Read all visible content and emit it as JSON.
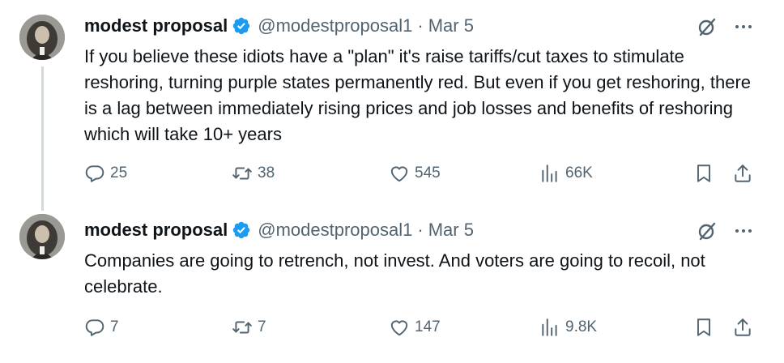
{
  "tweets": [
    {
      "author": {
        "name": "modest proposal",
        "handle": "@modestproposal1",
        "verified": true
      },
      "separator": "·",
      "date": "Mar 5",
      "text": "If you believe these idiots have a \"plan\" it's raise tariffs/cut taxes to stimulate reshoring, turning purple states permanently red. But even if you get reshoring, there is a lag between immediately rising prices and job losses and benefits of reshoring which will take 10+ years",
      "stats": {
        "replies": "25",
        "reposts": "38",
        "likes": "545",
        "views": "66K"
      }
    },
    {
      "author": {
        "name": "modest proposal",
        "handle": "@modestproposal1",
        "verified": true
      },
      "separator": "·",
      "date": "Mar 5",
      "text": "Companies are going to retrench, not invest. And voters are going to recoil, not celebrate.",
      "stats": {
        "replies": "7",
        "reposts": "7",
        "likes": "147",
        "views": "9.8K"
      }
    }
  ],
  "icons": {
    "verified": "verified-badge-icon",
    "grok": "grok-icon",
    "more": "more-icon",
    "reply": "reply-icon",
    "repost": "repost-icon",
    "like": "like-icon",
    "views": "views-icon",
    "bookmark": "bookmark-icon",
    "share": "share-icon"
  },
  "colors": {
    "verified": "#1d9bf0",
    "text": "#0f1419",
    "secondary": "#536471",
    "thread_line": "#cfd9de"
  }
}
